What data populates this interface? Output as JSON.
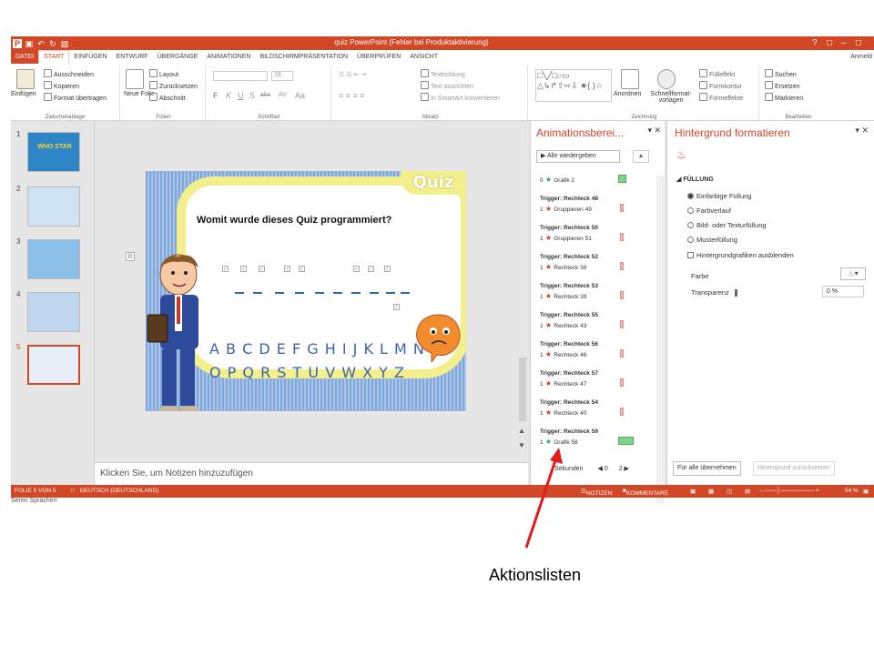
{
  "title_bar": {
    "text": "quiz  PowerPoint (Fehler bei Produktaktivierung)",
    "help": "?",
    "restore": "□",
    "minimize": "–",
    "close": "□"
  },
  "tabs": [
    "DATEI",
    "START",
    "EINFÜGEN",
    "ENTWURF",
    "ÜBERGÄNGE",
    "ANIMATIONEN",
    "BILDSCHIRMPRÄSENTATION",
    "ÜBERPRÜFEN",
    "ANSICHT"
  ],
  "active_tab": "START",
  "signin": "Anmeld",
  "ribbon": {
    "clipboard": {
      "paste": "Einfügen",
      "cut": "Ausschneiden",
      "copy": "Kopieren",
      "format_painter": "Format übertragen",
      "label": "Zwischenablage"
    },
    "slides": {
      "new_slide": "Neue Folie",
      "layout": "Layout",
      "reset": "Zurücksetzen",
      "section": "Abschnitt",
      "label": "Folien"
    },
    "font": {
      "font_size": "18",
      "bold": "F",
      "italic": "K",
      "underline": "U",
      "shadow": "S",
      "strike": "abc",
      "spacing": "AV",
      "case": "Aa",
      "label": "Schriftart"
    },
    "paragraph": {
      "text_direction": "Textrichtung",
      "align_text": "Text ausrichten",
      "smartart": "In SmartArt konvertieren",
      "label": "Absatz"
    },
    "drawing": {
      "arrange": "Anordnen",
      "quick_styles": "Schnellformat-vorlagen",
      "fill": "Fülleffekt",
      "outline": "Formkontur",
      "effects": "Formeffekte",
      "label": "Zeichnung"
    },
    "editing": {
      "find": "Suchen",
      "replace": "Ersetzen",
      "select": "Markieren",
      "label": "Bearbeiten"
    }
  },
  "slide_numbers": [
    "1",
    "2",
    "3",
    "4",
    "5"
  ],
  "slide_thumb_labels": {
    "thumb1": "WHO STAR"
  },
  "current_slide": {
    "badge": "Quiz",
    "question": "Womit wurde dieses Quiz programmiert?",
    "letters_row1": "A B C D E F G H I J K L M N",
    "letters_row2": "O P Q R S T U V W X Y Z",
    "side_marker": "0"
  },
  "notes_placeholder": "Klicken Sie, um Notizen hinzuzufügen",
  "animation_pane": {
    "title": "Animationsberei...",
    "controls": "▾  ✕",
    "play_button": "Alle wiedergeben",
    "rows": [
      {
        "trigger": "",
        "index": "0",
        "effect": "Grafik 2",
        "kind": "green"
      },
      {
        "trigger": "Trigger: Rechteck 48",
        "index": "1",
        "effect": "Gruppieren 49",
        "kind": "red"
      },
      {
        "trigger": "Trigger: Rechteck 50",
        "index": "1",
        "effect": "Gruppieren 51",
        "kind": "red"
      },
      {
        "trigger": "Trigger: Rechteck 52",
        "index": "1",
        "effect": "Rechteck 38",
        "kind": "red"
      },
      {
        "trigger": "Trigger: Rechteck 53",
        "index": "1",
        "effect": "Rechteck 39",
        "kind": "red"
      },
      {
        "trigger": "Trigger: Rechteck 55",
        "index": "1",
        "effect": "Rechteck 43",
        "kind": "red"
      },
      {
        "trigger": "Trigger: Rechteck 56",
        "index": "1",
        "effect": "Rechteck 46",
        "kind": "red"
      },
      {
        "trigger": "Trigger: Rechteck 57",
        "index": "1",
        "effect": "Rechteck 47",
        "kind": "red"
      },
      {
        "trigger": "Trigger: Rechteck 54",
        "index": "1",
        "effect": "Rechteck 40",
        "kind": "red"
      },
      {
        "trigger": "Trigger: Rechteck 59",
        "index": "1",
        "effect": "Grafik 58",
        "kind": "green-wide"
      }
    ],
    "footer_seconds": "Sekunden",
    "footer_zero": "0",
    "footer_two": "2"
  },
  "format_pane": {
    "title": "Hintergrund formatieren",
    "controls": "▾  ✕",
    "section": "FÜLLUNG",
    "options": [
      {
        "label": "Einfarbige Füllung",
        "checked": true
      },
      {
        "label": "Farbverlauf",
        "checked": false
      },
      {
        "label": "Bild- oder Texturfüllung",
        "checked": false
      },
      {
        "label": "Musterfüllung",
        "checked": false
      }
    ],
    "hide_graphics": "Hintergrundgrafiken ausblenden",
    "color_label": "Farbe",
    "transparency_label": "Transparenz",
    "transparency_value": "0 %",
    "apply_all": "Für alle übernehmen",
    "reset_background": "Hintergrund zurücksetzen"
  },
  "status_bar": {
    "slide_info": "FOLIE 5 VON 5",
    "language": "DEUTSCH (DEUTSCHLAND)",
    "notes": "NOTIZEN",
    "comments": "KOMMENTARE",
    "zoom": "54 %"
  },
  "under_status": "Seren Sprachen",
  "caption": "Aktionslisten",
  "colors": {
    "accent": "#d24726",
    "slide_blue": "#3a63b0",
    "board_yellow": "#f3ef8c"
  }
}
